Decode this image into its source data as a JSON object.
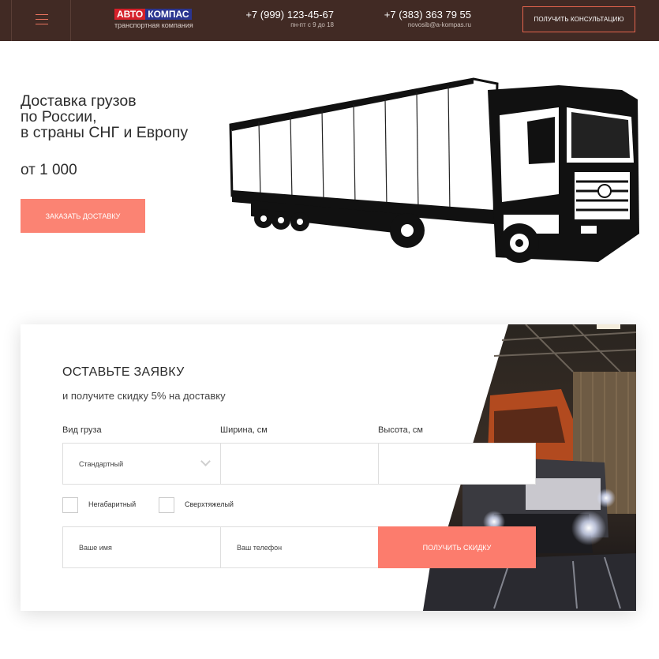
{
  "header": {
    "logo_part1": "АВТО",
    "logo_part2": "КОМПАС",
    "logo_sub": "транспортная компания",
    "phone1": "+7 (999) 123-45-67",
    "phone1_sub": "пн-пт с 9 до 18",
    "phone2": "+7 (383) 363 79 55",
    "email": "novosib@a-kompas.ru",
    "consult_button": "ПОЛУЧИТЬ КОНСУЛЬТАЦИЮ"
  },
  "hero": {
    "title": "Доставка грузов\nпо России,\nв страны СНГ и Европу",
    "price": "от 1 000",
    "order_button": "ЗАКАЗАТЬ ДОСТАВКУ"
  },
  "form": {
    "title": "ОСТАВЬТЕ ЗАЯВКУ",
    "subtitle": "и получите скидку 5% на доставку",
    "cargo_label": "Вид груза",
    "width_label": "Ширина, см",
    "height_label": "Высота, см",
    "cargo_value": "Стандартный",
    "oversize_label": "Негабаритный",
    "heavy_label": "Сверхтяжелый",
    "name_placeholder": "Ваше имя",
    "phone_placeholder": "Ваш телефон",
    "submit_button": "ПОЛУЧИТЬ СКИДКУ"
  },
  "colors": {
    "header_bg": "#412a24",
    "accent": "#fb8373",
    "logo_red": "#d6202a",
    "logo_blue": "#2b3590"
  }
}
